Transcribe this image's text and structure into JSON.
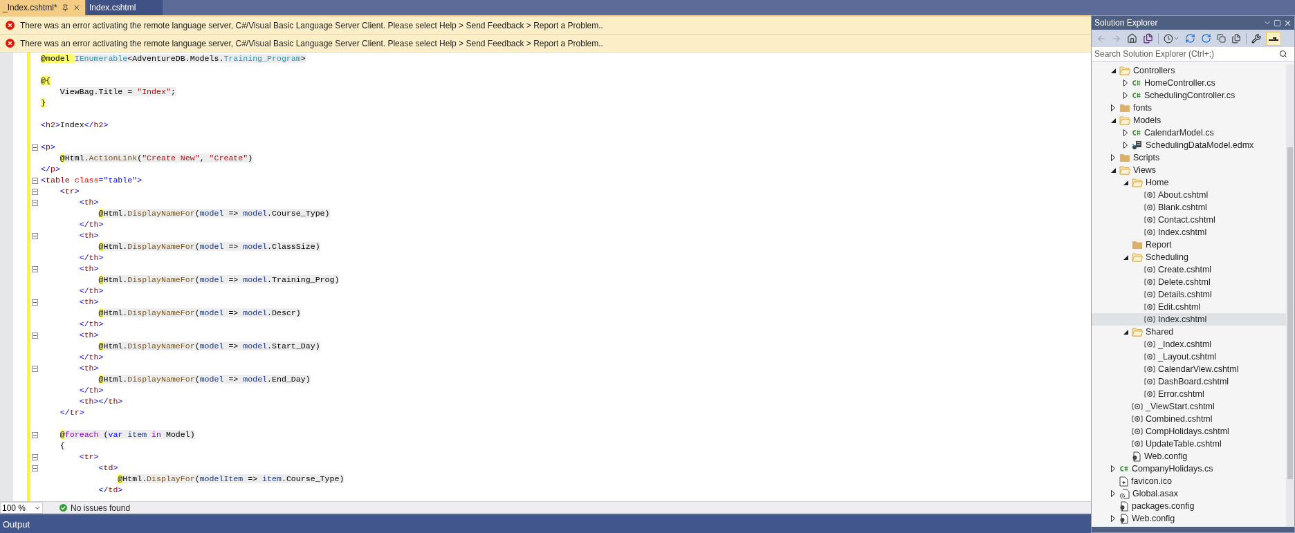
{
  "tabs": [
    {
      "label": "_Index.cshtml*",
      "selected": true
    },
    {
      "label": "Index.cshtml",
      "selected": false
    }
  ],
  "infobars": [
    {
      "message": "There was an error activating the remote language server, C#/Visual Basic Language Server Client. Please select Help > Send Feedback > Report a Problem.."
    },
    {
      "message": "There was an error activating the remote language server, C#/Visual Basic Language Server Client. Please select Help > Send Feedback > Report a Problem.."
    }
  ],
  "editor": {
    "modified": true,
    "lines": [
      {
        "kind": "razor",
        "tokens": [
          {
            "text": "@model ",
            "kind": "at"
          },
          {
            "text": "IEnumerable",
            "kind": "ty"
          },
          {
            "text": "<AdventureDB.Models.",
            "kind": "x"
          },
          {
            "text": "Training_Program",
            "kind": "ty"
          },
          {
            "text": ">",
            "kind": "x"
          }
        ]
      },
      {
        "kind": "blank"
      },
      {
        "kind": "razor",
        "tokens": [
          {
            "text": "@{",
            "kind": "at"
          }
        ]
      },
      {
        "kind": "razor",
        "tokens": [
          {
            "text": "    ViewBag.Title = ",
            "kind": "x"
          },
          {
            "text": "\"Index\"",
            "kind": "s"
          },
          {
            "text": ";",
            "kind": "x"
          }
        ]
      },
      {
        "kind": "razor",
        "tokens": [
          {
            "text": "}",
            "kind": "at"
          }
        ]
      },
      {
        "kind": "blank"
      },
      {
        "kind": "markup",
        "tokens": [
          {
            "text": "<",
            "kind": "p"
          },
          {
            "text": "h2",
            "kind": "tn"
          },
          {
            "text": ">",
            "kind": "p"
          },
          {
            "text": "Index",
            "kind": "x"
          },
          {
            "text": "</",
            "kind": "p"
          },
          {
            "text": "h2",
            "kind": "tn"
          },
          {
            "text": ">",
            "kind": "p"
          }
        ]
      },
      {
        "kind": "blank"
      },
      {
        "kind": "markup",
        "expanded": true,
        "tokens": [
          {
            "text": "<",
            "kind": "p"
          },
          {
            "text": "p",
            "kind": "tn"
          },
          {
            "text": ">",
            "kind": "p"
          }
        ]
      },
      {
        "kind": "razor",
        "tokens": [
          {
            "text": "    @",
            "kind": "at"
          },
          {
            "text": "Html.",
            "kind": "x"
          },
          {
            "text": "ActionLink",
            "kind": "m"
          },
          {
            "text": "(",
            "kind": "x"
          },
          {
            "text": "\"Create New\"",
            "kind": "s"
          },
          {
            "text": ", ",
            "kind": "x"
          },
          {
            "text": "\"Create\"",
            "kind": "s"
          },
          {
            "text": ")",
            "kind": "x"
          }
        ]
      },
      {
        "kind": "markup",
        "tokens": [
          {
            "text": "</",
            "kind": "p"
          },
          {
            "text": "p",
            "kind": "tn"
          },
          {
            "text": ">",
            "kind": "p"
          }
        ]
      },
      {
        "kind": "markup",
        "expanded": true,
        "tokens": [
          {
            "text": "<",
            "kind": "p"
          },
          {
            "text": "table ",
            "kind": "tn"
          },
          {
            "text": "class",
            "kind": "a"
          },
          {
            "text": "=\"table\">",
            "kind": "p"
          }
        ]
      },
      {
        "kind": "markup",
        "expanded": true,
        "tokens": [
          {
            "text": "    <",
            "kind": "p"
          },
          {
            "text": "tr",
            "kind": "tn"
          },
          {
            "text": ">",
            "kind": "p"
          }
        ]
      },
      {
        "kind": "markup",
        "expanded": true,
        "tokens": [
          {
            "text": "        <",
            "kind": "p"
          },
          {
            "text": "th",
            "kind": "tn"
          },
          {
            "text": ">",
            "kind": "p"
          }
        ]
      },
      {
        "kind": "razor",
        "tokens": [
          {
            "text": "            @",
            "kind": "at"
          },
          {
            "text": "Html.",
            "kind": "x"
          },
          {
            "text": "DisplayNameFor",
            "kind": "m"
          },
          {
            "text": "(",
            "kind": "x"
          },
          {
            "text": "model",
            "kind": "v"
          },
          {
            "text": " => ",
            "kind": "x"
          },
          {
            "text": "model",
            "kind": "v"
          },
          {
            "text": ".Course_Type)",
            "kind": "x"
          }
        ]
      },
      {
        "kind": "markup",
        "tokens": [
          {
            "text": "        </",
            "kind": "p"
          },
          {
            "text": "th",
            "kind": "tn"
          },
          {
            "text": ">",
            "kind": "p"
          }
        ]
      },
      {
        "kind": "markup",
        "expanded": true,
        "tokens": [
          {
            "text": "        <",
            "kind": "p"
          },
          {
            "text": "th",
            "kind": "tn"
          },
          {
            "text": ">",
            "kind": "p"
          }
        ]
      },
      {
        "kind": "razor",
        "tokens": [
          {
            "text": "            @",
            "kind": "at"
          },
          {
            "text": "Html.",
            "kind": "x"
          },
          {
            "text": "DisplayNameFor",
            "kind": "m"
          },
          {
            "text": "(",
            "kind": "x"
          },
          {
            "text": "model",
            "kind": "v"
          },
          {
            "text": " => ",
            "kind": "x"
          },
          {
            "text": "model",
            "kind": "v"
          },
          {
            "text": ".ClassSize)",
            "kind": "x"
          }
        ]
      },
      {
        "kind": "markup",
        "tokens": [
          {
            "text": "        </",
            "kind": "p"
          },
          {
            "text": "th",
            "kind": "tn"
          },
          {
            "text": ">",
            "kind": "p"
          }
        ]
      },
      {
        "kind": "markup",
        "expanded": true,
        "tokens": [
          {
            "text": "        <",
            "kind": "p"
          },
          {
            "text": "th",
            "kind": "tn"
          },
          {
            "text": ">",
            "kind": "p"
          }
        ]
      },
      {
        "kind": "razor",
        "tokens": [
          {
            "text": "            @",
            "kind": "at"
          },
          {
            "text": "Html.",
            "kind": "x"
          },
          {
            "text": "DisplayNameFor",
            "kind": "m"
          },
          {
            "text": "(",
            "kind": "x"
          },
          {
            "text": "model",
            "kind": "v"
          },
          {
            "text": " => ",
            "kind": "x"
          },
          {
            "text": "model",
            "kind": "v"
          },
          {
            "text": ".Training_Prog)",
            "kind": "x"
          }
        ]
      },
      {
        "kind": "markup",
        "tokens": [
          {
            "text": "        </",
            "kind": "p"
          },
          {
            "text": "th",
            "kind": "tn"
          },
          {
            "text": ">",
            "kind": "p"
          }
        ]
      },
      {
        "kind": "markup",
        "expanded": true,
        "tokens": [
          {
            "text": "        <",
            "kind": "p"
          },
          {
            "text": "th",
            "kind": "tn"
          },
          {
            "text": ">",
            "kind": "p"
          }
        ]
      },
      {
        "kind": "razor",
        "tokens": [
          {
            "text": "            @",
            "kind": "at"
          },
          {
            "text": "Html.",
            "kind": "x"
          },
          {
            "text": "DisplayNameFor",
            "kind": "m"
          },
          {
            "text": "(",
            "kind": "x"
          },
          {
            "text": "model",
            "kind": "v"
          },
          {
            "text": " => ",
            "kind": "x"
          },
          {
            "text": "model",
            "kind": "v"
          },
          {
            "text": ".Descr)",
            "kind": "x"
          }
        ]
      },
      {
        "kind": "markup",
        "tokens": [
          {
            "text": "        </",
            "kind": "p"
          },
          {
            "text": "th",
            "kind": "tn"
          },
          {
            "text": ">",
            "kind": "p"
          }
        ]
      },
      {
        "kind": "markup",
        "expanded": true,
        "tokens": [
          {
            "text": "        <",
            "kind": "p"
          },
          {
            "text": "th",
            "kind": "tn"
          },
          {
            "text": ">",
            "kind": "p"
          }
        ]
      },
      {
        "kind": "razor",
        "tokens": [
          {
            "text": "            @",
            "kind": "at"
          },
          {
            "text": "Html.",
            "kind": "x"
          },
          {
            "text": "DisplayNameFor",
            "kind": "m"
          },
          {
            "text": "(",
            "kind": "x"
          },
          {
            "text": "model",
            "kind": "v"
          },
          {
            "text": " => ",
            "kind": "x"
          },
          {
            "text": "model",
            "kind": "v"
          },
          {
            "text": ".Start_Day)",
            "kind": "x"
          }
        ]
      },
      {
        "kind": "markup",
        "tokens": [
          {
            "text": "        </",
            "kind": "p"
          },
          {
            "text": "th",
            "kind": "tn"
          },
          {
            "text": ">",
            "kind": "p"
          }
        ]
      },
      {
        "kind": "markup",
        "expanded": true,
        "tokens": [
          {
            "text": "        <",
            "kind": "p"
          },
          {
            "text": "th",
            "kind": "tn"
          },
          {
            "text": ">",
            "kind": "p"
          }
        ]
      },
      {
        "kind": "razor",
        "tokens": [
          {
            "text": "            @",
            "kind": "at"
          },
          {
            "text": "Html.",
            "kind": "x"
          },
          {
            "text": "DisplayNameFor",
            "kind": "m"
          },
          {
            "text": "(",
            "kind": "x"
          },
          {
            "text": "model",
            "kind": "v"
          },
          {
            "text": " => ",
            "kind": "x"
          },
          {
            "text": "model",
            "kind": "v"
          },
          {
            "text": ".End_Day)",
            "kind": "x"
          }
        ]
      },
      {
        "kind": "markup",
        "tokens": [
          {
            "text": "        </",
            "kind": "p"
          },
          {
            "text": "th",
            "kind": "tn"
          },
          {
            "text": ">",
            "kind": "p"
          }
        ]
      },
      {
        "kind": "markup",
        "tokens": [
          {
            "text": "        <",
            "kind": "p"
          },
          {
            "text": "th",
            "kind": "tn"
          },
          {
            "text": "></",
            "kind": "p"
          },
          {
            "text": "th",
            "kind": "tn"
          },
          {
            "text": ">",
            "kind": "p"
          }
        ]
      },
      {
        "kind": "markup",
        "tokens": [
          {
            "text": "    </",
            "kind": "p"
          },
          {
            "text": "tr",
            "kind": "tn"
          },
          {
            "text": ">",
            "kind": "p"
          }
        ]
      },
      {
        "kind": "blank"
      },
      {
        "kind": "razor",
        "expanded": true,
        "tokens": [
          {
            "text": "    @",
            "kind": "at"
          },
          {
            "text": "foreach",
            "kind": "ctl"
          },
          {
            "text": " (",
            "kind": "x"
          },
          {
            "text": "var ",
            "kind": "kw"
          },
          {
            "text": "item ",
            "kind": "v"
          },
          {
            "text": "in",
            "kind": "ctl"
          },
          {
            "text": " Model)",
            "kind": "x"
          }
        ]
      },
      {
        "kind": "markup",
        "tokens": [
          {
            "text": "    {",
            "kind": "x"
          }
        ]
      },
      {
        "kind": "markup",
        "expanded": true,
        "tokens": [
          {
            "text": "        <",
            "kind": "p"
          },
          {
            "text": "tr",
            "kind": "tn"
          },
          {
            "text": ">",
            "kind": "p"
          }
        ]
      },
      {
        "kind": "markup",
        "expanded": true,
        "tokens": [
          {
            "text": "            <",
            "kind": "p"
          },
          {
            "text": "td",
            "kind": "tn"
          },
          {
            "text": ">",
            "kind": "p"
          }
        ]
      },
      {
        "kind": "razor",
        "tokens": [
          {
            "text": "                @",
            "kind": "at"
          },
          {
            "text": "Html.",
            "kind": "x"
          },
          {
            "text": "DisplayFor",
            "kind": "m"
          },
          {
            "text": "(",
            "kind": "x"
          },
          {
            "text": "modelItem",
            "kind": "v"
          },
          {
            "text": " => ",
            "kind": "x"
          },
          {
            "text": "item",
            "kind": "v"
          },
          {
            "text": ".Course_Type)",
            "kind": "x"
          }
        ]
      },
      {
        "kind": "markup",
        "tokens": [
          {
            "text": "            </",
            "kind": "p"
          },
          {
            "text": "td",
            "kind": "tn"
          },
          {
            "text": ">",
            "kind": "p"
          }
        ]
      }
    ]
  },
  "editor_status": {
    "zoom": "100 %",
    "issues": "No issues found"
  },
  "output_panel": {
    "title": "Output"
  },
  "solution_explorer": {
    "title": "Solution Explorer",
    "search": {
      "placeholder": "Search Solution Explorer (Ctrl+;)"
    },
    "tree": [
      {
        "label": "Controllers",
        "kind": "folder",
        "expanded": true,
        "selected": false,
        "children": [
          {
            "label": "HomeController.cs",
            "kind": "cs",
            "expanded": false,
            "selected": false
          },
          {
            "label": "SchedulingController.cs",
            "kind": "cs",
            "expanded": false,
            "selected": false
          }
        ]
      },
      {
        "label": "fonts",
        "kind": "folder",
        "expanded": false,
        "selected": false
      },
      {
        "label": "Models",
        "kind": "folder",
        "expanded": true,
        "selected": false,
        "children": [
          {
            "label": "CalendarModel.cs",
            "kind": "cs",
            "expanded": false,
            "selected": false
          },
          {
            "label": "SchedulingDataModel.edmx",
            "kind": "edmx",
            "expanded": false,
            "selected": false
          }
        ]
      },
      {
        "label": "Scripts",
        "kind": "folder",
        "expanded": false,
        "selected": false
      },
      {
        "label": "Views",
        "kind": "folder",
        "expanded": true,
        "selected": false,
        "children": [
          {
            "label": "Home",
            "kind": "folder",
            "expanded": true,
            "selected": false,
            "children": [
              {
                "label": "About.cshtml",
                "kind": "cshtml",
                "selected": false
              },
              {
                "label": "Blank.cshtml",
                "kind": "cshtml",
                "selected": false
              },
              {
                "label": "Contact.cshtml",
                "kind": "cshtml",
                "selected": false
              },
              {
                "label": "Index.cshtml",
                "kind": "cshtml",
                "selected": false
              }
            ]
          },
          {
            "label": "Report",
            "kind": "folder",
            "selected": false
          },
          {
            "label": "Scheduling",
            "kind": "folder",
            "expanded": true,
            "selected": false,
            "children": [
              {
                "label": "Create.cshtml",
                "kind": "cshtml",
                "selected": false
              },
              {
                "label": "Delete.cshtml",
                "kind": "cshtml",
                "selected": false
              },
              {
                "label": "Details.cshtml",
                "kind": "cshtml",
                "selected": false
              },
              {
                "label": "Edit.cshtml",
                "kind": "cshtml",
                "selected": false
              },
              {
                "label": "Index.cshtml",
                "kind": "cshtml",
                "selected": true
              }
            ]
          },
          {
            "label": "Shared",
            "kind": "folder",
            "expanded": true,
            "selected": false,
            "children": [
              {
                "label": "_Index.cshtml",
                "kind": "cshtml",
                "selected": false
              },
              {
                "label": "_Layout.cshtml",
                "kind": "cshtml",
                "selected": false
              },
              {
                "label": "CalendarView.cshtml",
                "kind": "cshtml",
                "selected": false
              },
              {
                "label": "DashBoard.cshtml",
                "kind": "cshtml",
                "selected": false
              },
              {
                "label": "Error.cshtml",
                "kind": "cshtml",
                "selected": false
              }
            ]
          },
          {
            "label": "_ViewStart.cshtml",
            "kind": "cshtml",
            "selected": false
          },
          {
            "label": "Combined.cshtml",
            "kind": "cshtml",
            "selected": false
          },
          {
            "label": "CompHolidays.cshtml",
            "kind": "cshtml",
            "selected": false
          },
          {
            "label": "UpdateTable.cshtml",
            "kind": "cshtml",
            "selected": false
          },
          {
            "label": "Web.config",
            "kind": "config",
            "selected": false
          }
        ]
      },
      {
        "label": "CompanyHolidays.cs",
        "kind": "cs",
        "expanded": false,
        "selected": false
      },
      {
        "label": "favicon.ico",
        "kind": "ico",
        "selected": false
      },
      {
        "label": "Global.asax",
        "kind": "asax",
        "expanded": false,
        "selected": false
      },
      {
        "label": "packages.config",
        "kind": "config",
        "selected": false
      },
      {
        "label": "Web.config",
        "kind": "config",
        "expanded": false,
        "selected": false
      }
    ]
  }
}
